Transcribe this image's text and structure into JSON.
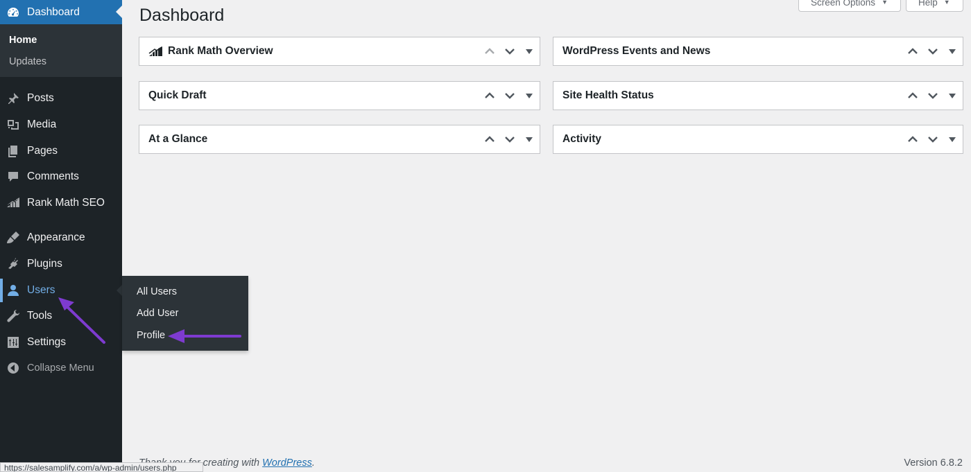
{
  "page": {
    "title": "Dashboard"
  },
  "top_tabs": {
    "screen_options": "Screen Options",
    "help": "Help"
  },
  "sidebar": {
    "dashboard": "Dashboard",
    "dashboard_sub": {
      "home": "Home",
      "updates": "Updates"
    },
    "items": [
      {
        "key": "posts",
        "label": "Posts",
        "icon": "pin-icon"
      },
      {
        "key": "media",
        "label": "Media",
        "icon": "media-icon"
      },
      {
        "key": "pages",
        "label": "Pages",
        "icon": "pages-icon"
      },
      {
        "key": "comments",
        "label": "Comments",
        "icon": "comment-icon"
      },
      {
        "key": "rankmath",
        "label": "Rank Math SEO",
        "icon": "rank-math-icon"
      },
      {
        "key": "appearance",
        "label": "Appearance",
        "icon": "brush-icon"
      },
      {
        "key": "plugins",
        "label": "Plugins",
        "icon": "plug-icon"
      },
      {
        "key": "users",
        "label": "Users",
        "icon": "user-icon"
      },
      {
        "key": "tools",
        "label": "Tools",
        "icon": "wrench-icon"
      },
      {
        "key": "settings",
        "label": "Settings",
        "icon": "settings-icon"
      },
      {
        "key": "collapse",
        "label": "Collapse Menu",
        "icon": "collapse-icon"
      }
    ],
    "users_flyout": [
      "All Users",
      "Add User",
      "Profile"
    ]
  },
  "widgets": {
    "left": [
      "Rank Math Overview",
      "Quick Draft",
      "At a Glance"
    ],
    "right": [
      "WordPress Events and News",
      "Site Health Status",
      "Activity"
    ]
  },
  "footer": {
    "thanks_prefix": "Thank you for creating with ",
    "thanks_link": "WordPress",
    "thanks_suffix": ".",
    "version": "Version 6.8.2"
  },
  "status_bar_url": "https://salesamplify.com/a/wp-admin/users.php",
  "colors": {
    "sidebar_bg": "#1d2327",
    "submenu_bg": "#2c3338",
    "accent_blue": "#2271b1",
    "active_blue": "#72aee6",
    "annotation_purple": "#7e3bd0"
  }
}
